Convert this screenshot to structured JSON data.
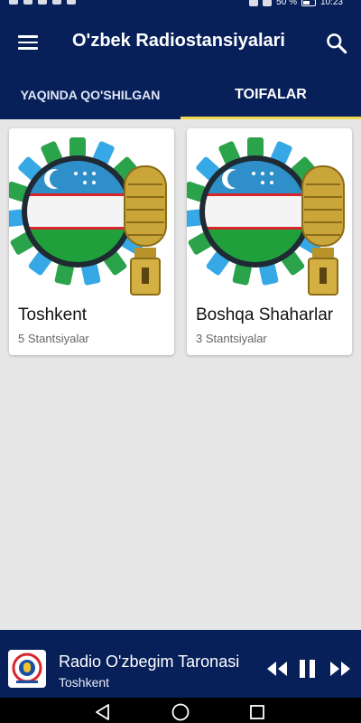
{
  "status_bar": {
    "battery": "50 %",
    "time": "10:23"
  },
  "app_bar": {
    "title": "O'zbek Radiostansiyalari",
    "menu_icon": "hamburger-menu-icon",
    "search_icon": "search-icon"
  },
  "tabs": [
    {
      "label": "YAQINDA QO'SHILGAN",
      "active": false
    },
    {
      "label": "TOIFALAR",
      "active": true
    }
  ],
  "categories": [
    {
      "title": "Toshkent",
      "subtitle": "5 Stantsiyalar",
      "image": "uzbek-flag-microphone-icon"
    },
    {
      "title": "Boshqa Shaharlar",
      "subtitle": "3 Stantsiyalar",
      "image": "uzbek-flag-microphone-icon"
    }
  ],
  "player": {
    "station": "Radio O'zbegim Taronasi",
    "city": "Toshkent",
    "controls": [
      "rewind-icon",
      "pause-icon",
      "fast-forward-icon"
    ]
  },
  "colors": {
    "primary": "#07205a",
    "accent": "#f0d64a",
    "background": "#e6e6e6"
  }
}
